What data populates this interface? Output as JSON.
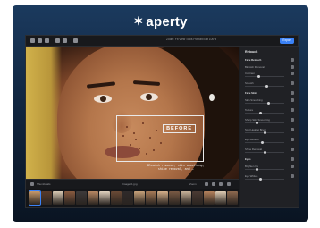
{
  "brand": {
    "logo_text": "aperty",
    "accent": "#3b82f6"
  },
  "toolbar": {
    "info_text": "Zoom: Fit  View  Tools  Portrait  Edit  100%",
    "export_label": "Export"
  },
  "overlay": {
    "before_label": "BEFORE",
    "caption_line1": "Blemish removal, skin smoothing,",
    "caption_line2": "shine removal, and …"
  },
  "panel": {
    "title": "Retouch",
    "rows": [
      {
        "label": "Face Retouch",
        "type": "head"
      },
      {
        "label": "Blemish Removal",
        "type": "item"
      },
      {
        "label": "Contrast",
        "type": "slider",
        "value": 0.35
      },
      {
        "label": "Smooth",
        "type": "slider",
        "value": 0.55
      },
      {
        "label": "Face Skin",
        "type": "head"
      },
      {
        "label": "Skin Smoothing",
        "type": "slider",
        "value": 0.6
      },
      {
        "label": "Texture",
        "type": "slider",
        "value": 0.4
      },
      {
        "label": "Sharp Skin Smoothing",
        "type": "slider",
        "value": 0.3
      },
      {
        "label": "Spot Healing Brush",
        "type": "slider",
        "value": 0.5
      },
      {
        "label": "Eye Retouch",
        "type": "slider",
        "value": 0.45
      },
      {
        "label": "Shine Removal",
        "type": "slider",
        "value": 0.5
      },
      {
        "label": "Eyes",
        "type": "head"
      },
      {
        "label": "Brighten Iris",
        "type": "slider",
        "value": 0.3
      },
      {
        "label": "Eye Whiten",
        "type": "slider",
        "value": 0.4
      }
    ]
  },
  "statusbar": {
    "left_text": "Thumbnails",
    "filename": "Image01.jpg",
    "zoom_text": "Zoom"
  },
  "filmstrip": {
    "thumb_colors": [
      "#c79a6c",
      "#5a3b2a",
      "#d9c9b4",
      "#8a5b3f",
      "#3d3a3a",
      "#b98863",
      "#e3d3c0",
      "#6b4a36",
      "#2f2a2a",
      "#c8a27a",
      "#a87b57",
      "#d6b08a",
      "#7a5a44",
      "#c8b39a",
      "#4a3a33",
      "#b6825c",
      "#e0cdb5",
      "#8f6a4f"
    ]
  }
}
